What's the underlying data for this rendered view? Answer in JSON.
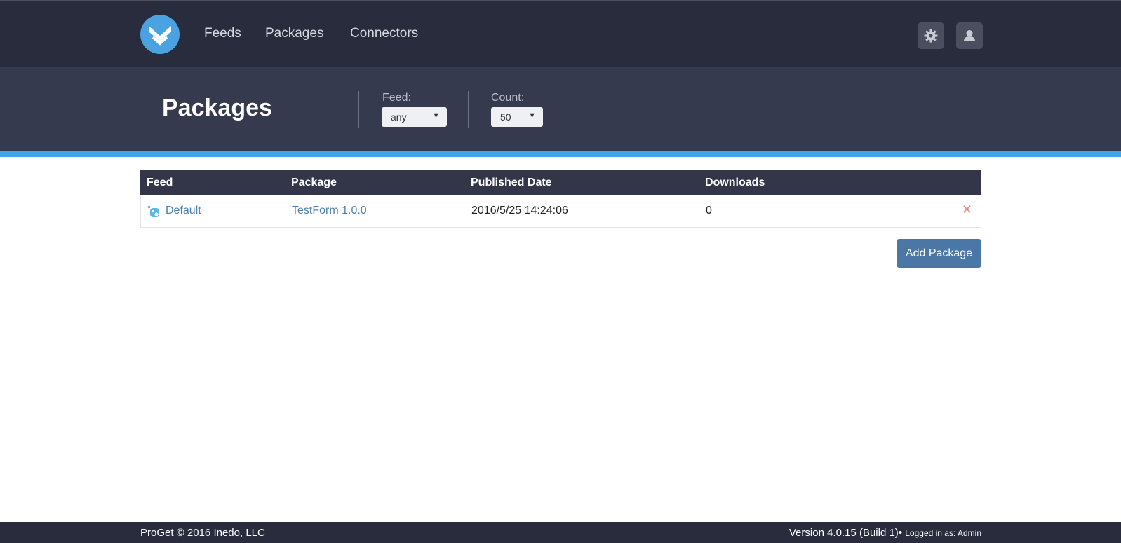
{
  "app": {
    "name": "ProGet"
  },
  "nav": {
    "items": [
      {
        "label": "Feeds"
      },
      {
        "label": "Packages"
      },
      {
        "label": "Connectors"
      }
    ],
    "settings_icon": "gear-icon",
    "user_icon": "user-icon"
  },
  "header": {
    "title": "Packages",
    "feed_filter": {
      "label": "Feed:",
      "value": "any"
    },
    "count_filter": {
      "label": "Count:",
      "value": "50"
    }
  },
  "table": {
    "columns": [
      "Feed",
      "Package",
      "Published Date",
      "Downloads"
    ],
    "rows": [
      {
        "feed": "Default",
        "package": "TestForm 1.0.0",
        "published": "2016/5/25 14:24:06",
        "downloads": "0",
        "delete_icon": "close-icon"
      }
    ]
  },
  "actions": {
    "add_package": "Add Package"
  },
  "footer": {
    "copyright": "ProGet © 2016 Inedo, LLC",
    "version": "Version 4.0.15 (Build 1)",
    "separator": "•",
    "logged_in": "Logged in as: Admin"
  },
  "colors": {
    "topbar": "#282c3c",
    "header": "#363a4e",
    "accent": "#3fa6ec",
    "button": "#4a77a6",
    "link": "#4c7fb0",
    "delete": "#e08a8a"
  }
}
